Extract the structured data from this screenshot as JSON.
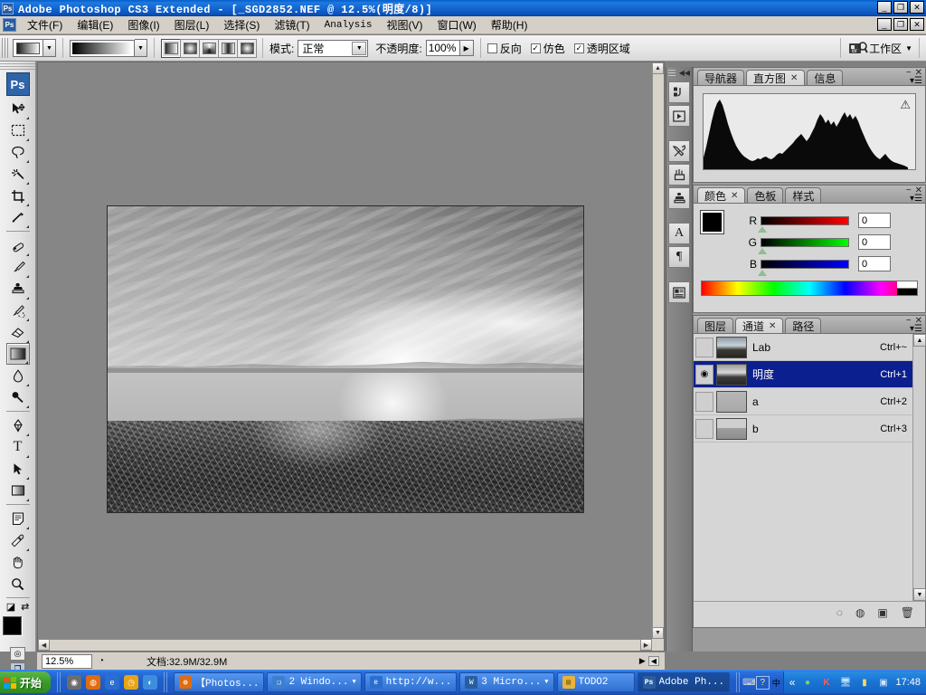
{
  "window": {
    "title": "Adobe Photoshop CS3 Extended - [_SGD2852.NEF @ 12.5%(明度/8)]",
    "app_icon": "Ps",
    "minimize": "_",
    "maximize": "❐",
    "close": "✕",
    "doc_minimize": "_",
    "doc_maximize": "❐",
    "doc_close": "✕"
  },
  "menubar": {
    "app_icon": "Ps",
    "items": [
      {
        "label": "文件(F)"
      },
      {
        "label": "编辑(E)"
      },
      {
        "label": "图像(I)"
      },
      {
        "label": "图层(L)"
      },
      {
        "label": "选择(S)"
      },
      {
        "label": "滤镜(T)"
      },
      {
        "label": "Analysis"
      },
      {
        "label": "视图(V)"
      },
      {
        "label": "窗口(W)"
      },
      {
        "label": "帮助(H)"
      }
    ]
  },
  "options_bar": {
    "tool": "gradient-tool",
    "preset_dropdown_arrow": "▼",
    "gradient_dropdown_arrow": "▼",
    "gradient_types": [
      {
        "name": "linear-gradient-button",
        "selected": true
      },
      {
        "name": "radial-gradient-button",
        "selected": false
      },
      {
        "name": "angle-gradient-button",
        "selected": false
      },
      {
        "name": "reflected-gradient-button",
        "selected": false
      },
      {
        "name": "diamond-gradient-button",
        "selected": false
      }
    ],
    "mode_label": "模式:",
    "mode_value": "正常",
    "mode_arrow": "▼",
    "opacity_label": "不透明度:",
    "opacity_value": "100%",
    "opacity_arrow": "▶",
    "reverse_label": "反向",
    "reverse_checked": false,
    "dither_label": "仿色",
    "dither_checked": true,
    "transparency_label": "透明区域",
    "transparency_checked": true,
    "bridge_icon": "Br",
    "workspace_label": "工作区",
    "workspace_arrow": "▼"
  },
  "toolbox": {
    "logo": "Ps",
    "tools": [
      {
        "name": "move-tool",
        "glyph": "➤",
        "has_flyout": true,
        "selected": false
      },
      {
        "name": "marquee-tool",
        "glyph": "▭",
        "has_flyout": true,
        "selected": false
      },
      {
        "name": "lasso-tool",
        "glyph": "◯",
        "has_flyout": true,
        "selected": false
      },
      {
        "name": "magic-wand-tool",
        "glyph": "✳",
        "has_flyout": true,
        "selected": false
      },
      {
        "name": "crop-tool",
        "glyph": "⌗",
        "has_flyout": true,
        "selected": false
      },
      {
        "name": "slice-tool",
        "glyph": "✂",
        "has_flyout": true,
        "selected": false
      },
      {
        "name": "healing-brush-tool",
        "glyph": "✒",
        "has_flyout": true,
        "selected": false
      },
      {
        "name": "brush-tool",
        "glyph": "✏",
        "has_flyout": true,
        "selected": false
      },
      {
        "name": "clone-stamp-tool",
        "glyph": "⚲",
        "has_flyout": true,
        "selected": false
      },
      {
        "name": "history-brush-tool",
        "glyph": "✎",
        "has_flyout": true,
        "selected": false
      },
      {
        "name": "eraser-tool",
        "glyph": "▱",
        "has_flyout": true,
        "selected": false
      },
      {
        "name": "gradient-tool",
        "glyph": "▦",
        "has_flyout": true,
        "selected": true
      },
      {
        "name": "blur-tool",
        "glyph": "💧",
        "has_flyout": true,
        "selected": false
      },
      {
        "name": "dodge-tool",
        "glyph": "◉",
        "has_flyout": true,
        "selected": false
      },
      {
        "name": "pen-tool",
        "glyph": "✑",
        "has_flyout": true,
        "selected": false
      },
      {
        "name": "type-tool",
        "glyph": "T",
        "has_flyout": true,
        "selected": false
      },
      {
        "name": "path-selection-tool",
        "glyph": "➚",
        "has_flyout": true,
        "selected": false
      },
      {
        "name": "shape-tool",
        "glyph": "▢",
        "has_flyout": true,
        "selected": false
      },
      {
        "name": "notes-tool",
        "glyph": "🗒",
        "has_flyout": true,
        "selected": false
      },
      {
        "name": "eyedropper-tool",
        "glyph": "⟋",
        "has_flyout": true,
        "selected": false
      },
      {
        "name": "hand-tool",
        "glyph": "✋",
        "has_flyout": false,
        "selected": false
      },
      {
        "name": "zoom-tool",
        "glyph": "🔍",
        "has_flyout": false,
        "selected": false
      }
    ],
    "foreground_color": "#000000",
    "background_color": "#ffffff",
    "default_colors_icon": "◪",
    "swap_colors_icon": "⇄",
    "quickmask_icon": "◎",
    "screenmode_icon": "❐"
  },
  "document": {
    "zoom_level": "12.5%",
    "doc_info_label": "文档:32.9M/32.9M",
    "doc_info_arrow": "▶",
    "proxy_arrow": "◀",
    "image_alt": "grayscale-lake-sunset-photo"
  },
  "dock_strip": {
    "collapse_icon": "◀◀",
    "buttons": [
      {
        "name": "history-panel-icon",
        "glyph": "↺"
      },
      {
        "name": "actions-panel-icon",
        "glyph": "▶"
      },
      {
        "name": "tool-presets-panel-icon",
        "glyph": "⚒"
      },
      {
        "name": "brushes-panel-icon",
        "glyph": "🖌"
      },
      {
        "name": "clone-source-panel-icon",
        "glyph": "⚱"
      },
      {
        "name": "character-panel-icon",
        "glyph": "A"
      },
      {
        "name": "paragraph-panel-icon",
        "glyph": "¶"
      },
      {
        "name": "layer-comps-panel-icon",
        "glyph": "▤"
      }
    ]
  },
  "histogram_panel": {
    "tabs": [
      {
        "label": "导航器",
        "active": false,
        "closable": false
      },
      {
        "label": "直方图",
        "active": true,
        "closable": true
      },
      {
        "label": "信息",
        "active": false,
        "closable": false
      }
    ],
    "close_icon": "✕",
    "minimize_icon": "−",
    "menu_icon": "▾☰",
    "warning_icon": "⚠",
    "tab_close_icon": "✕"
  },
  "color_panel": {
    "tabs": [
      {
        "label": "颜色",
        "active": true,
        "closable": true
      },
      {
        "label": "色板",
        "active": false,
        "closable": false
      },
      {
        "label": "样式",
        "active": false,
        "closable": false
      }
    ],
    "close_icon": "✕",
    "minimize_icon": "−",
    "menu_icon": "▾☰",
    "tab_close_icon": "✕",
    "channels": [
      {
        "label": "R",
        "value": "0"
      },
      {
        "label": "G",
        "value": "0"
      },
      {
        "label": "B",
        "value": "0"
      }
    ],
    "foreground_color": "#000000",
    "background_color": "#ffffff"
  },
  "channels_panel": {
    "tabs": [
      {
        "label": "图层",
        "active": false,
        "closable": false
      },
      {
        "label": "通道",
        "active": true,
        "closable": true
      },
      {
        "label": "路径",
        "active": false,
        "closable": false
      }
    ],
    "close_icon": "✕",
    "minimize_icon": "−",
    "menu_icon": "▾☰",
    "tab_close_icon": "✕",
    "eye_icon": "◉",
    "rows": [
      {
        "name": "Lab",
        "shortcut": "Ctrl+~",
        "visible": false,
        "selected": false,
        "thumb": "ct-lab"
      },
      {
        "name": "明度",
        "shortcut": "Ctrl+1",
        "visible": true,
        "selected": true,
        "thumb": "ct-light"
      },
      {
        "name": "a",
        "shortcut": "Ctrl+2",
        "visible": false,
        "selected": false,
        "thumb": "ct-a"
      },
      {
        "name": "b",
        "shortcut": "Ctrl+3",
        "visible": false,
        "selected": false,
        "thumb": "ct-b"
      }
    ],
    "footer_buttons": [
      {
        "name": "load-channel-as-selection-button",
        "glyph": "◌"
      },
      {
        "name": "save-selection-as-channel-button",
        "glyph": "◍"
      },
      {
        "name": "create-new-channel-button",
        "glyph": "▣"
      },
      {
        "name": "delete-channel-button",
        "glyph": "🗑"
      }
    ],
    "scroll_up": "▲",
    "scroll_down": "▼"
  },
  "taskbar": {
    "start_label": "开始",
    "quick_launch": [
      {
        "name": "media-player-quicklaunch-icon",
        "glyph": "◉",
        "color": "#6d6d6d"
      },
      {
        "name": "firefox-quicklaunch-icon",
        "glyph": "e",
        "color": "#e06c10"
      },
      {
        "name": "internet-explorer-quicklaunch-icon",
        "glyph": "e",
        "color": "#2a6fd0"
      },
      {
        "name": "clock-quicklaunch-icon",
        "glyph": "◷",
        "color": "#e8a317"
      },
      {
        "name": "messenger-quicklaunch-icon",
        "glyph": "◐",
        "color": "#3b8ede"
      }
    ],
    "items": [
      {
        "name": "taskitem-photoshop-tutorial",
        "label": "【Photos...",
        "icon": "◉",
        "icon_color": "#e06c10",
        "has_dropdown": false
      },
      {
        "name": "taskitem-windows-group",
        "label": "2 Windo...",
        "icon": "👥",
        "icon_color": "#3b7fd0",
        "has_dropdown": true
      },
      {
        "name": "taskitem-browser",
        "label": "http://w...",
        "icon": "e",
        "icon_color": "#2a6fd0",
        "has_dropdown": false
      },
      {
        "name": "taskitem-word-group",
        "label": "3 Micro...",
        "icon": "W",
        "icon_color": "#2a5d9e",
        "has_dropdown": true
      },
      {
        "name": "taskitem-todo2-folder",
        "label": "TODO2",
        "icon": "📁",
        "icon_color": "#e8b33c",
        "has_dropdown": false
      },
      {
        "name": "taskitem-photoshop",
        "label": "Adobe Ph...",
        "icon": "Ps",
        "icon_color": "#2a5d9e",
        "has_dropdown": false
      }
    ],
    "tray": {
      "keyboard_icon": "⌨",
      "help_icon": "?",
      "lang_indicator": "中",
      "expand_icon": "«",
      "icons": [
        {
          "name": "user-account-tray-icon",
          "glyph": "👤",
          "color": "#58b050"
        },
        {
          "name": "kaspersky-tray-icon",
          "glyph": "K",
          "color": "#cc2222"
        },
        {
          "name": "network-tray-icon",
          "glyph": "🖧",
          "color": "#3b7fd0"
        },
        {
          "name": "volume-tray-icon",
          "glyph": "📶",
          "color": "#e8a317"
        },
        {
          "name": "monitor-tray-icon",
          "glyph": "🖥",
          "color": "#4a6fa0"
        }
      ],
      "clock": "17:48"
    }
  }
}
